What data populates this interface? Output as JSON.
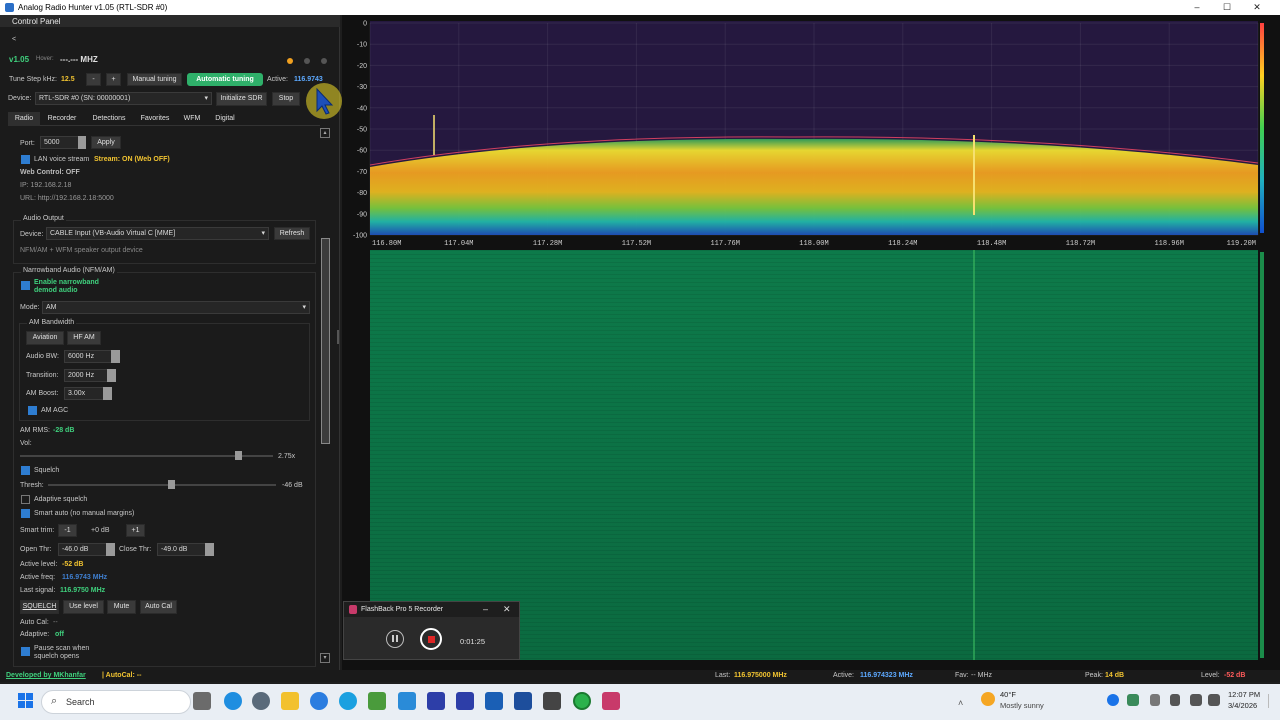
{
  "window": {
    "title": "Analog Radio Hunter v1.05 (RTL-SDR #0)",
    "minimize": "–",
    "maximize": "☐",
    "close": "✕"
  },
  "panel": {
    "title": "Control Panel",
    "back": "<",
    "version": "v1.05",
    "hover_label": "Hover:",
    "hover_value": "---.--- MHZ",
    "tune_step_label": "Tune Step kHz:",
    "tune_step_value": "12.5",
    "minus": "-",
    "plus": "+",
    "manual_tuning": "Manual tuning",
    "automatic_tuning": "Automatic tuning",
    "active_label": "Active:",
    "active_value": "116.9743",
    "device_label": "Device:",
    "device_value": "RTL-SDR #0 (SN: 00000001)",
    "init_sdr": "Initialize SDR",
    "stop": "Stop",
    "tabs": [
      "Radio",
      "Recorder",
      "Detections",
      "Favorites",
      "WFM",
      "Digital"
    ],
    "port_label": "Port:",
    "port_value": "5000",
    "apply": "Apply",
    "lan_voice": "LAN voice stream",
    "stream_status": "Stream: ON (Web OFF)",
    "web_control": "Web Control: OFF",
    "ip": "IP: 192.168.2.18",
    "url": "URL: http://192.168.2.18:5000",
    "audio_output": "Audio Output",
    "audio_device_label": "Device:",
    "audio_device_value": "CABLE Input (VB-Audio Virtual C [MME]",
    "refresh": "Refresh",
    "audio_note": "NFM/AM + WFM speaker output device",
    "narrowband": "Narrowband Audio (NFM/AM)",
    "enable_nb": "Enable narrowband demod audio",
    "mode_label": "Mode:",
    "mode_value": "AM",
    "am_bandwidth": "AM Bandwidth",
    "aviation": "Aviation",
    "hf_am": "HF AM",
    "audio_bw_label": "Audio BW:",
    "audio_bw_value": "6000 Hz",
    "transition_label": "Transition:",
    "transition_value": "2000 Hz",
    "am_boost_label": "AM Boost:",
    "am_boost_value": "3.00x",
    "am_agc": "AM AGC",
    "am_rms_label": "AM RMS:",
    "am_rms_value": "-28 dB",
    "vol_label": "Vol:",
    "vol_value": "2.75x",
    "vol_level": 0.86,
    "squelch": "Squelch",
    "thresh_label": "Thresh:",
    "thresh_value": "-46 dB",
    "thresh_level": 0.54,
    "adaptive_squelch": "Adaptive squelch",
    "smart_auto": "Smart auto (no manual margins)",
    "smart_trim_label": "Smart trim:",
    "trim_minus": "-1",
    "trim_value": "+0 dB",
    "trim_plus": "+1",
    "open_thr_label": "Open Thr:",
    "open_thr_value": "-46.0 dB",
    "close_thr_label": "Close Thr:",
    "close_thr_value": "-49.0 dB",
    "active_level_label": "Active level:",
    "active_level_value": "-52 dB",
    "active_freq_label": "Active freq:",
    "active_freq_value": "116.9743 MHz",
    "last_signal_label": "Last signal:",
    "last_signal_value": "116.9750 MHz",
    "squelch_btn": "SQUELCH",
    "use_level": "Use level",
    "mute": "Mute",
    "auto_cal_btn": "Auto Cal",
    "auto_cal_label": "Auto Cal:",
    "auto_cal_value": "--",
    "adaptive_label": "Adaptive:",
    "adaptive_value": "off",
    "pause_scan": "Pause scan when squelch opens"
  },
  "spectrum": {
    "db_ticks": [
      "0",
      "-10",
      "-20",
      "-30",
      "-40",
      "-50",
      "-60",
      "-70",
      "-80",
      "-90",
      "-100"
    ],
    "freq_ticks": [
      "116.80M",
      "117.04M",
      "117.28M",
      "117.52M",
      "117.76M",
      "118.00M",
      "118.24M",
      "118.48M",
      "118.72M",
      "118.96M",
      "119.20M"
    ]
  },
  "status": {
    "developer": "Developed by MKhanfar",
    "autocal": "| AutoCal: --",
    "last_label": "Last:",
    "last_value": "116.975000 MHz",
    "active_label": "Active:",
    "active_value": "116.974323 MHz",
    "fav_label": "Fav:",
    "fav_value": "-- MHz",
    "peak_label": "Peak:",
    "peak_value": "14 dB",
    "level_label": "Level:",
    "level_value": "-52 dB"
  },
  "recorder": {
    "title": "FlashBack Pro 5 Recorder",
    "time": "0:01:25",
    "minimize": "–",
    "close": "✕"
  },
  "taskbar": {
    "search": "Search",
    "weather_temp": "40°F",
    "weather_desc": "Mostly sunny",
    "time": "12:07 PM",
    "date": "3/4/2026"
  },
  "colors": {
    "accent_green": "#2fb06a",
    "value_yellow": "#f2c431",
    "value_blue": "#5da9ff",
    "checkbox_blue": "#2e7dd1"
  }
}
